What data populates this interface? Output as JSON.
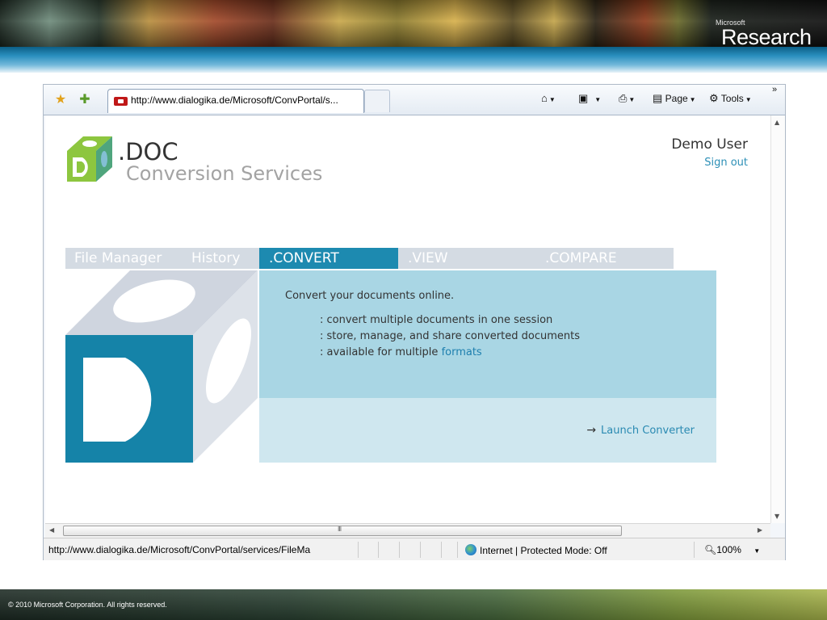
{
  "slide": {
    "brand_small": "Microsoft",
    "brand_big": "Research",
    "copyright": "© 2010 Microsoft Corporation. All rights reserved."
  },
  "browser": {
    "tab_title": "http://www.dialogika.de/Microsoft/ConvPortal/s...",
    "commands": {
      "home_icon": "home-icon",
      "feeds_icon": "feeds-icon",
      "print_icon": "print-icon",
      "page_label": "Page",
      "tools_label": "Tools",
      "chevron": "»"
    },
    "status": {
      "url": "http://www.dialogika.de/Microsoft/ConvPortal/services/FileMa",
      "zone": "Internet | Protected Mode: Off",
      "zoom": "100%"
    },
    "scroll_grip": "III"
  },
  "page": {
    "logo_title": ".DOC",
    "logo_subtitle": "Conversion Services",
    "user_name": "Demo User",
    "sign_out": "Sign out",
    "nav": [
      {
        "label": "File Manager"
      },
      {
        "label": "History"
      },
      {
        "label": ".CONVERT",
        "active": true
      },
      {
        "label": ".VIEW"
      },
      {
        "label": ".COMPARE"
      }
    ],
    "panel": {
      "intro": "Convert your documents online.",
      "bullets": [
        ": convert multiple documents in one session",
        ": store, manage, and share converted documents",
        ": available for multiple "
      ],
      "formats_link": "formats",
      "launch_arrow": "→",
      "launch_label": "Launch Converter"
    }
  },
  "colors": {
    "accent": "#1d8ab0",
    "panel_dark": "#a9d6e4",
    "panel_light": "#cfe7ef",
    "nav_bg": "#d4dbe3",
    "logo_green": "#8dc63f"
  }
}
